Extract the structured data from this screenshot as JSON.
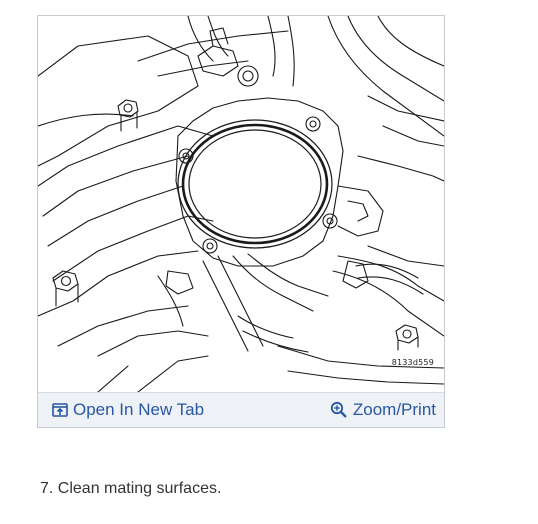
{
  "figure": {
    "code": "8133d559",
    "open_tab_label": "Open In New Tab",
    "zoom_label": "Zoom/Print",
    "open_tab_icon": "open-in-new-tab-icon",
    "zoom_icon": "magnifier-plus-icon",
    "link_color": "#2857a4",
    "toolbar_bg": "#eef1f6"
  },
  "step": {
    "text": "7. Clean mating surfaces."
  }
}
